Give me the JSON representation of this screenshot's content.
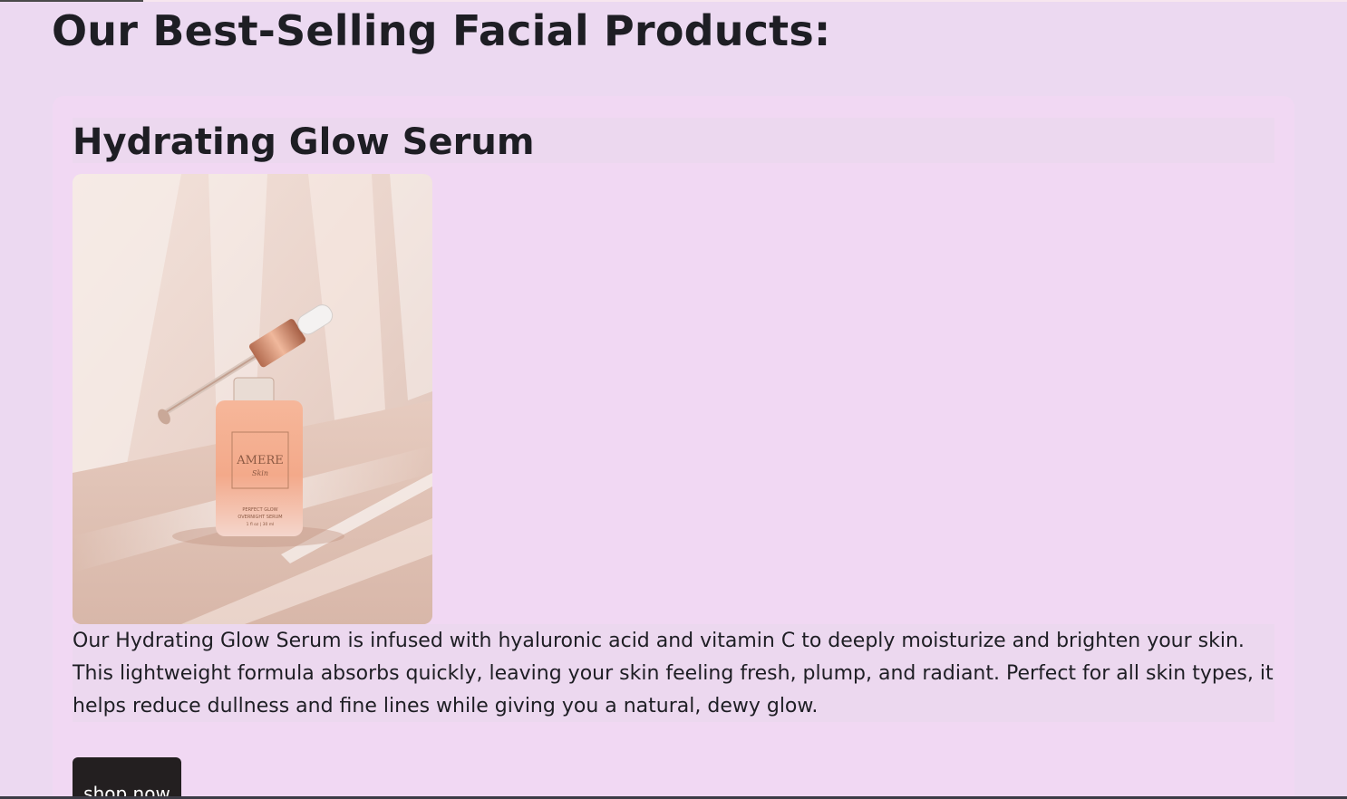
{
  "page": {
    "title": "Our Best-Selling Facial Products:"
  },
  "product": {
    "name": "Hydrating Glow Serum",
    "image_alt": "Hydrating Glow Serum bottle with dropper",
    "image_label_brand": "AMERE",
    "image_label_sub": "Skin",
    "image_label_line1": "PERFECT GLOW",
    "image_label_line2": "OVERNIGHT SERUM",
    "image_label_line3": "1 fl oz | 30 ml",
    "description": "Our Hydrating Glow Serum is infused with hyaluronic acid and vitamin C to deeply moisturize and brighten your skin. This lightweight formula absorbs quickly, leaving your skin feeling fresh, plump, and radiant. Perfect for all skin types, it helps reduce dullness and fine lines while giving you a natural, dewy glow.",
    "cta_label": "shop now"
  },
  "colors": {
    "page_background": "#ecd9f1",
    "card_background": "#f1d8f3",
    "button_background": "#231f20",
    "text": "#1e1e24"
  }
}
